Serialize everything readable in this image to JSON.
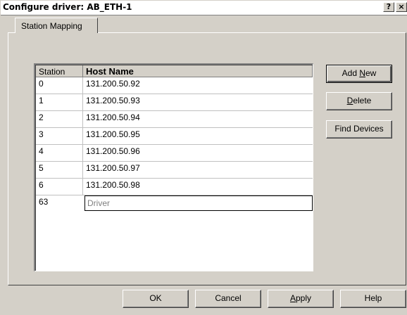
{
  "window": {
    "title": "Configure driver: AB_ETH-1",
    "help_glyph": "?",
    "close_glyph": "×"
  },
  "tab": {
    "label": "Station Mapping"
  },
  "table": {
    "columns": [
      "Station",
      "Host Name"
    ],
    "rows": [
      {
        "station": "0",
        "host": "131.200.50.92"
      },
      {
        "station": "1",
        "host": "131.200.50.93"
      },
      {
        "station": "2",
        "host": "131.200.50.94"
      },
      {
        "station": "3",
        "host": "131.200.50.95"
      },
      {
        "station": "4",
        "host": "131.200.50.96"
      },
      {
        "station": "5",
        "host": "131.200.50.97"
      },
      {
        "station": "6",
        "host": "131.200.50.98"
      }
    ],
    "driver_row": {
      "station": "63",
      "host": "Driver"
    }
  },
  "side_buttons": {
    "add_new_pre": "Add ",
    "add_new_key": "N",
    "add_new_post": "ew",
    "delete_key": "D",
    "delete_post": "elete",
    "find_devices": "Find Devices"
  },
  "footer_buttons": {
    "ok": "OK",
    "cancel": "Cancel",
    "apply_key": "A",
    "apply_post": "pply",
    "help": "Help"
  }
}
